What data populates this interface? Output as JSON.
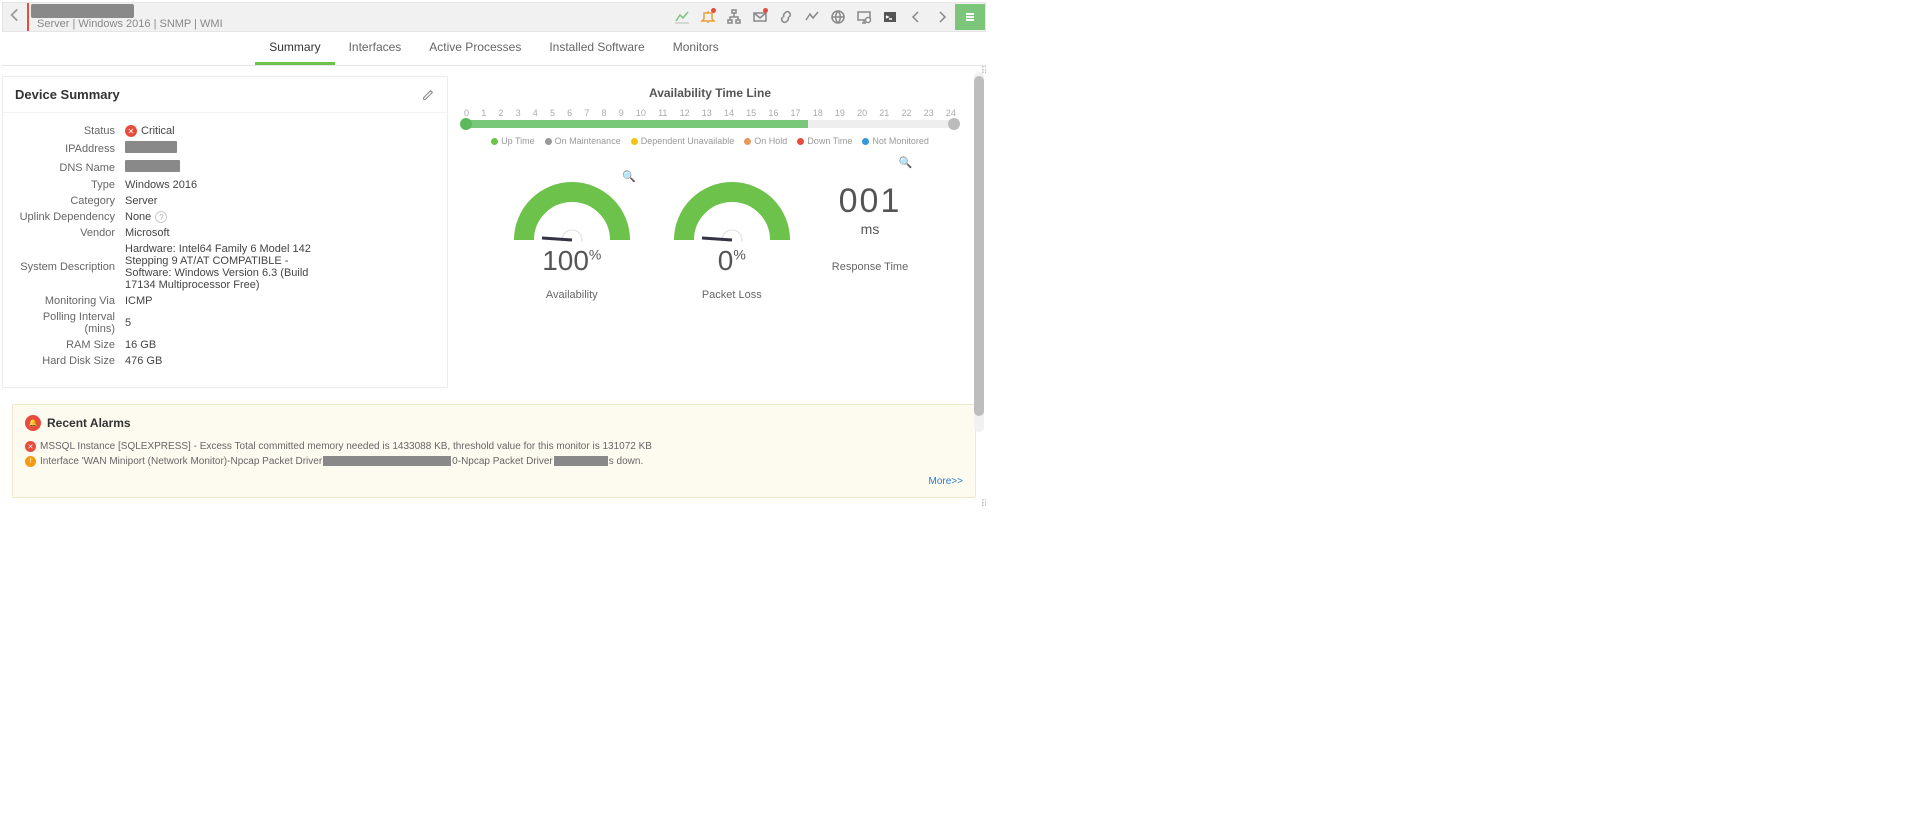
{
  "header": {
    "breadcrumb": "Server | Windows 2016  | SNMP  | WMI"
  },
  "tabs": {
    "summary": "Summary",
    "interfaces": "Interfaces",
    "processes": "Active Processes",
    "software": "Installed Software",
    "monitors": "Monitors"
  },
  "deviceSummary": {
    "title": "Device Summary",
    "labels": {
      "status": "Status",
      "ip": "IPAddress",
      "dns": "DNS Name",
      "type": "Type",
      "category": "Category",
      "uplink": "Uplink Dependency",
      "vendor": "Vendor",
      "sysdesc": "System Description",
      "monvia": "Monitoring Via",
      "polling": "Polling Interval (mins)",
      "ram": "RAM Size",
      "disk": "Hard Disk Size"
    },
    "values": {
      "status": "Critical",
      "type": "Windows 2016",
      "category": "Server",
      "uplink": "None",
      "vendor": "Microsoft",
      "sysdesc": "Hardware: Intel64 Family 6 Model 142 Stepping 9 AT/AT COMPATIBLE - Software: Windows Version 6.3 (Build 17134 Multiprocessor Free)",
      "monvia": "ICMP",
      "polling": "5",
      "ram": "16 GB",
      "disk": "476 GB"
    }
  },
  "timeline": {
    "title": "Availability Time Line",
    "ticks": [
      "0",
      "1",
      "2",
      "3",
      "4",
      "5",
      "6",
      "7",
      "8",
      "9",
      "10",
      "11",
      "12",
      "13",
      "14",
      "15",
      "16",
      "17",
      "18",
      "19",
      "20",
      "21",
      "22",
      "23",
      "24"
    ],
    "legend": {
      "up": "Up Time",
      "maint": "On Maintenance",
      "dep": "Dependent Unavailable",
      "hold": "On Hold",
      "down": "Down Time",
      "notmon": "Not Monitored"
    }
  },
  "gauges": {
    "availability_value": "100",
    "availability_label": "Availability",
    "packetloss_value": "0",
    "packetloss_label": "Packet Loss",
    "percent": "%",
    "response_value": "001",
    "response_unit": "ms",
    "response_label": "Response Time"
  },
  "alarms": {
    "title": "Recent Alarms",
    "item1": "MSSQL Instance [SQLEXPRESS] - Excess Total committed memory needed is 1433088 KB, threshold value for this monitor is 131072 KB",
    "item2_a": "Interface 'WAN Miniport (Network Monitor)-Npcap Packet Driver",
    "item2_b": "0-Npcap Packet Driver",
    "item2_c": "s down.",
    "more": "More>>"
  },
  "chart_data": {
    "type": "table",
    "title": "Device Summary Gauges",
    "gauges": [
      {
        "name": "Availability",
        "value": 100,
        "unit": "%"
      },
      {
        "name": "Packet Loss",
        "value": 0,
        "unit": "%"
      },
      {
        "name": "Response Time",
        "value": 1,
        "unit": "ms"
      }
    ],
    "timeline": {
      "hours_total": 24,
      "uptime_fraction_estimate": 0.7
    }
  }
}
